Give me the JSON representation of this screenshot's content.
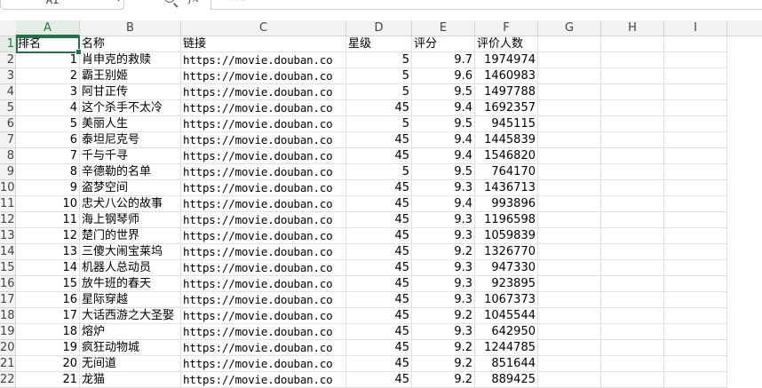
{
  "formula_bar": {
    "cell_ref": "A1",
    "content": "排名",
    "zoom_icon": "zoom-icon",
    "fx_label": "fx"
  },
  "columns": [
    "A",
    "B",
    "C",
    "D",
    "E",
    "F",
    "G",
    "H",
    "I"
  ],
  "rows": [
    "1",
    "2",
    "3",
    "4",
    "5",
    "6",
    "7",
    "8",
    "9",
    "10",
    "11",
    "12",
    "13",
    "14",
    "15",
    "16",
    "17",
    "18",
    "19",
    "20",
    "21",
    "22"
  ],
  "headers": [
    "排名",
    "名称",
    "链接",
    "星级",
    "评分",
    "评价人数"
  ],
  "movies": [
    {
      "rank": "1",
      "name": "肖申克的救赎",
      "url": "https://movie.douban.co",
      "stars": "5",
      "score": "9.7",
      "votes": "1974974"
    },
    {
      "rank": "2",
      "name": "霸王别姬",
      "url": "https://movie.douban.co",
      "stars": "5",
      "score": "9.6",
      "votes": "1460983"
    },
    {
      "rank": "3",
      "name": "阿甘正传",
      "url": "https://movie.douban.co",
      "stars": "5",
      "score": "9.5",
      "votes": "1497788"
    },
    {
      "rank": "4",
      "name": "这个杀手不太冷",
      "url": "https://movie.douban.co",
      "stars": "45",
      "score": "9.4",
      "votes": "1692357"
    },
    {
      "rank": "5",
      "name": "美丽人生",
      "url": "https://movie.douban.co",
      "stars": "5",
      "score": "9.5",
      "votes": "945115"
    },
    {
      "rank": "6",
      "name": "泰坦尼克号",
      "url": "https://movie.douban.co",
      "stars": "45",
      "score": "9.4",
      "votes": "1445839"
    },
    {
      "rank": "7",
      "name": "千与千寻",
      "url": "https://movie.douban.co",
      "stars": "45",
      "score": "9.4",
      "votes": "1546820"
    },
    {
      "rank": "8",
      "name": "辛德勒的名单",
      "url": "https://movie.douban.co",
      "stars": "5",
      "score": "9.5",
      "votes": "764170"
    },
    {
      "rank": "9",
      "name": "盗梦空间",
      "url": "https://movie.douban.co",
      "stars": "45",
      "score": "9.3",
      "votes": "1436713"
    },
    {
      "rank": "10",
      "name": "忠犬八公的故事",
      "url": "https://movie.douban.co",
      "stars": "45",
      "score": "9.4",
      "votes": "993896"
    },
    {
      "rank": "11",
      "name": "海上钢琴师",
      "url": "https://movie.douban.co",
      "stars": "45",
      "score": "9.3",
      "votes": "1196598"
    },
    {
      "rank": "12",
      "name": "楚门的世界",
      "url": "https://movie.douban.co",
      "stars": "45",
      "score": "9.3",
      "votes": "1059839"
    },
    {
      "rank": "13",
      "name": "三傻大闹宝莱坞",
      "url": "https://movie.douban.co",
      "stars": "45",
      "score": "9.2",
      "votes": "1326770"
    },
    {
      "rank": "14",
      "name": "机器人总动员",
      "url": "https://movie.douban.co",
      "stars": "45",
      "score": "9.3",
      "votes": "947330"
    },
    {
      "rank": "15",
      "name": "放牛班的春天",
      "url": "https://movie.douban.co",
      "stars": "45",
      "score": "9.3",
      "votes": "923895"
    },
    {
      "rank": "16",
      "name": "星际穿越",
      "url": "https://movie.douban.co",
      "stars": "45",
      "score": "9.3",
      "votes": "1067373"
    },
    {
      "rank": "17",
      "name": "大话西游之大圣娶",
      "url": "https://movie.douban.co",
      "stars": "45",
      "score": "9.2",
      "votes": "1045544"
    },
    {
      "rank": "18",
      "name": "熔炉",
      "url": "https://movie.douban.co",
      "stars": "45",
      "score": "9.3",
      "votes": "642950"
    },
    {
      "rank": "19",
      "name": "疯狂动物城",
      "url": "https://movie.douban.co",
      "stars": "45",
      "score": "9.2",
      "votes": "1244785"
    },
    {
      "rank": "20",
      "name": "无间道",
      "url": "https://movie.douban.co",
      "stars": "45",
      "score": "9.2",
      "votes": "851644"
    },
    {
      "rank": "21",
      "name": "龙猫",
      "url": "https://movie.douban.co",
      "stars": "45",
      "score": "9.2",
      "votes": "889425"
    }
  ]
}
